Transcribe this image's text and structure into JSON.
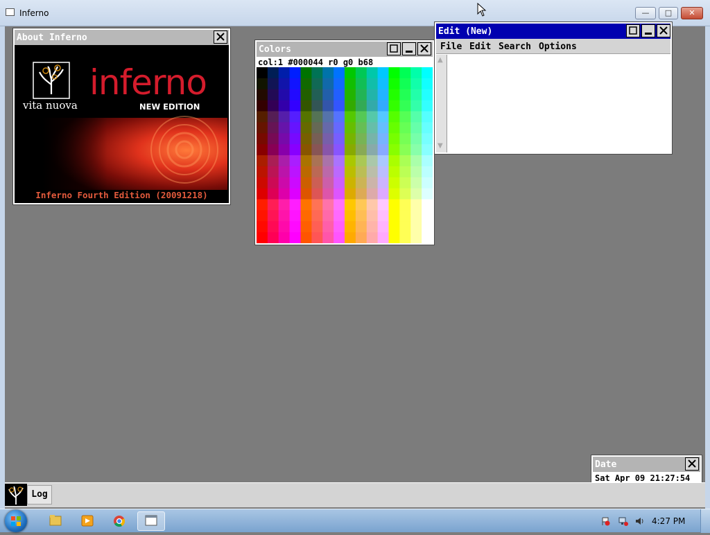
{
  "host_window": {
    "title": "Inferno",
    "min_label": "—",
    "max_label": "□",
    "close_label": "✕"
  },
  "about_window": {
    "title": "About Inferno",
    "vendor": "vita nuova",
    "product": "inferno",
    "edition_badge": "NEW EDITION",
    "caption": "Inferno Fourth Edition (20091218)",
    "brand_color": "#d41c2c"
  },
  "colors_window": {
    "title": "Colors",
    "status": "col:1 #000044 r0 g0 b68"
  },
  "edit_window": {
    "title": "Edit (New)",
    "menu": [
      "File",
      "Edit",
      "Search",
      "Options"
    ],
    "title_color": "#0000b0"
  },
  "date_window": {
    "title": "Date",
    "value": "Sat Apr 09 21:27:54"
  },
  "inferno_taskbar": {
    "items": [
      {
        "label": "Log"
      }
    ]
  },
  "windows_taskbar": {
    "time": "4:27 PM",
    "apps": [
      "explorer-icon",
      "media-player-icon",
      "chrome-icon",
      "inferno-app-icon"
    ],
    "tray": [
      "action-center-flag-icon",
      "network-icon",
      "volume-icon"
    ]
  }
}
